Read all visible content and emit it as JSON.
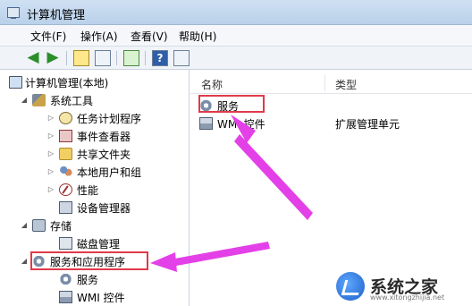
{
  "window": {
    "title": "计算机管理"
  },
  "menu": [
    "文件(F)",
    "操作(A)",
    "查看(V)",
    "帮助(H)"
  ],
  "toolbar": {
    "buttons": [
      "back-icon",
      "forward-icon",
      "up-folder-icon",
      "show-tree-icon",
      "export-icon",
      "help-icon",
      "properties-icon"
    ]
  },
  "tree": {
    "root": "计算机管理(本地)",
    "system_tools": "系统工具",
    "task_scheduler": "任务计划程序",
    "event_viewer": "事件查看器",
    "shared_folders": "共享文件夹",
    "local_users": "本地用户和组",
    "performance": "性能",
    "device_manager": "设备管理器",
    "storage": "存储",
    "disk_management": "磁盘管理",
    "services_apps": "服务和应用程序",
    "services": "服务",
    "wmi": "WMI 控件"
  },
  "list": {
    "col_name": "名称",
    "col_type": "类型",
    "rows": [
      {
        "name": "服务",
        "type": ""
      },
      {
        "name": "WMI 控件",
        "type": "扩展管理单元"
      }
    ]
  },
  "annotation_colors": {
    "box": "#e03a4a",
    "arrow": "#e440e8"
  },
  "watermark": {
    "text": "系统之家",
    "url": "www.xitongzhijia.net"
  }
}
